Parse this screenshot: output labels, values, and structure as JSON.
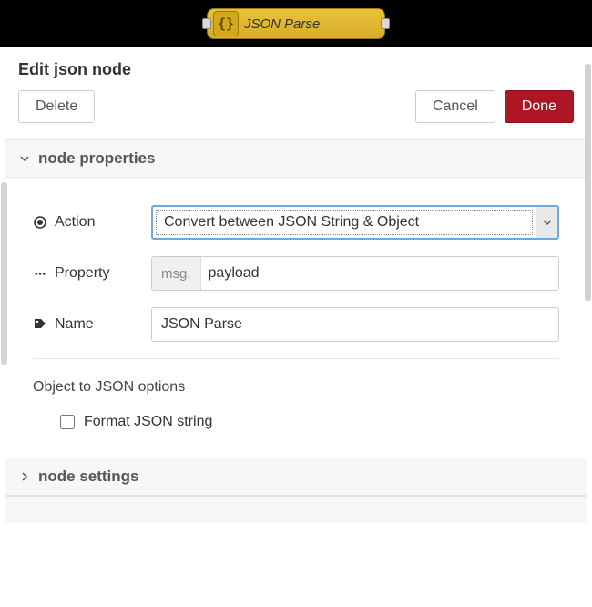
{
  "node_pill": {
    "icon_text": "{}",
    "label": "JSON Parse"
  },
  "header": {
    "title": "Edit json node"
  },
  "buttons": {
    "delete": "Delete",
    "cancel": "Cancel",
    "done": "Done"
  },
  "sections": {
    "properties": {
      "title": "node properties",
      "expanded": true
    },
    "settings": {
      "title": "node settings",
      "expanded": false
    }
  },
  "form": {
    "action": {
      "label": "Action",
      "value": "Convert between JSON String & Object"
    },
    "property": {
      "label": "Property",
      "prefix": "msg.",
      "value": "payload"
    },
    "name": {
      "label": "Name",
      "value": "JSON Parse"
    },
    "json_options_title": "Object to JSON options",
    "format_checkbox": {
      "label": "Format JSON string",
      "checked": false
    }
  }
}
